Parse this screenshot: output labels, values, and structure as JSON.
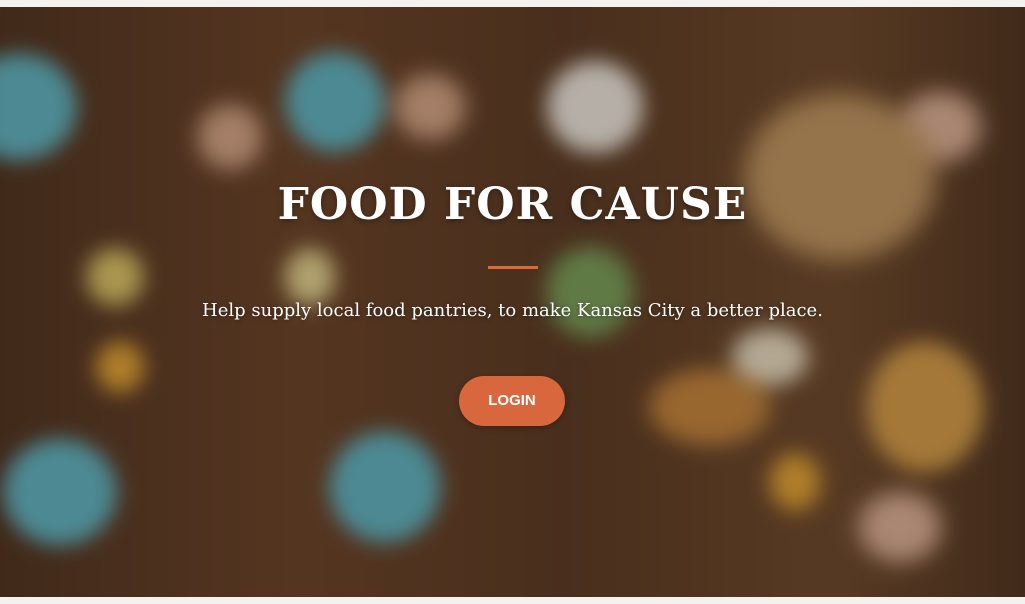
{
  "hero": {
    "title": "FOOD FOR CAUSE",
    "subtitle": "Help supply local food pantries, to make Kansas City a better place.",
    "login_label": "LOGIN"
  },
  "colors": {
    "accent": "#d9673d",
    "divider": "#d96a3b",
    "text": "#ffffff"
  }
}
